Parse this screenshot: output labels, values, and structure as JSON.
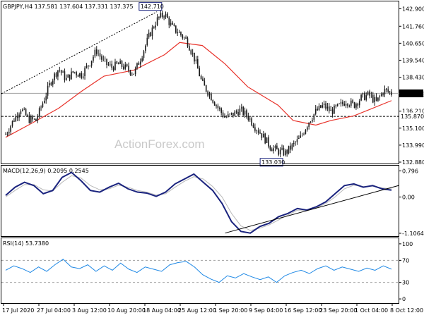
{
  "chart_data": [
    {
      "type": "candlestick",
      "header": "GBPJPY,H4  137.581 137.604 137.331 137.375",
      "watermark": "ActionForex.com",
      "ylim": [
        132.88,
        143.2
      ],
      "yticks": [
        132.88,
        133.99,
        135.1,
        136.21,
        137.32,
        138.43,
        139.54,
        140.65,
        141.76,
        142.9
      ],
      "ytick_labels": [
        "132.880",
        "133.990",
        "135.100",
        "136.210",
        "137.320",
        "138.430",
        "139.540",
        "140.650",
        "141.760",
        "142.900"
      ],
      "last_price": 137.375,
      "last_price_label": "137.375",
      "level_line": 135.87,
      "level_label": "135.870",
      "high_annotation": {
        "value": 142.71,
        "label": "142.710"
      },
      "low_annotation": {
        "value": 133.03,
        "label": "133.030"
      },
      "trendline": {
        "from": {
          "x": "17 Jul 2020",
          "y": 137.35
        },
        "to": {
          "x": "27 Aug 2020",
          "y": 142.71
        }
      },
      "price_path": [
        [
          "17 Jul",
          134.7
        ],
        [
          "20 Jul",
          135.6
        ],
        [
          "22 Jul",
          136.4
        ],
        [
          "24 Jul",
          135.7
        ],
        [
          "27 Jul",
          135.6
        ],
        [
          "28 Jul",
          136.9
        ],
        [
          "30 Jul",
          138.2
        ],
        [
          "31 Jul",
          139.0
        ],
        [
          "3 Aug",
          138.3
        ],
        [
          "5 Aug",
          138.8
        ],
        [
          "7 Aug",
          138.6
        ],
        [
          "10 Aug",
          139.3
        ],
        [
          "12 Aug",
          140.2
        ],
        [
          "14 Aug",
          139.4
        ],
        [
          "17 Aug",
          139.1
        ],
        [
          "18 Aug",
          139.3
        ],
        [
          "20 Aug",
          139.0
        ],
        [
          "21 Aug",
          138.7
        ],
        [
          "24 Aug",
          139.9
        ],
        [
          "26 Aug",
          141.2
        ],
        [
          "27 Aug",
          142.2
        ],
        [
          "28 Aug",
          142.6
        ],
        [
          "31 Aug",
          141.7
        ],
        [
          "1 Sep",
          141.3
        ],
        [
          "2 Sep",
          140.8
        ],
        [
          "3 Sep",
          139.6
        ],
        [
          "4 Sep",
          138.0
        ],
        [
          "7 Sep",
          137.3
        ],
        [
          "8 Sep",
          136.5
        ],
        [
          "9 Sep",
          135.8
        ],
        [
          "10 Sep",
          136.0
        ],
        [
          "11 Sep",
          136.3
        ],
        [
          "14 Sep",
          135.9
        ],
        [
          "15 Sep",
          135.2
        ],
        [
          "16 Sep",
          134.6
        ],
        [
          "17 Sep",
          133.9
        ],
        [
          "18 Sep",
          133.6
        ],
        [
          "21 Sep",
          133.5
        ],
        [
          "22 Sep",
          134.0
        ],
        [
          "23 Sep",
          134.5
        ],
        [
          "24 Sep",
          135.5
        ],
        [
          "25 Sep",
          136.2
        ],
        [
          "28 Sep",
          136.6
        ],
        [
          "29 Sep",
          136.2
        ],
        [
          "30 Sep",
          136.5
        ],
        [
          "1 Oct",
          136.9
        ],
        [
          "2 Oct",
          136.6
        ],
        [
          "5 Oct",
          137.1
        ],
        [
          "6 Oct",
          137.3
        ],
        [
          "7 Oct",
          136.8
        ],
        [
          "8 Oct",
          137.6
        ],
        [
          "9 Oct",
          137.4
        ]
      ],
      "ma_path": [
        [
          "17 Jul",
          134.5
        ],
        [
          "24 Jul",
          135.3
        ],
        [
          "31 Jul",
          136.4
        ],
        [
          "7 Aug",
          137.5
        ],
        [
          "14 Aug",
          138.5
        ],
        [
          "21 Aug",
          138.9
        ],
        [
          "28 Aug",
          139.9
        ],
        [
          "1 Sep",
          140.7
        ],
        [
          "4 Sep",
          140.5
        ],
        [
          "9 Sep",
          139.3
        ],
        [
          "14 Sep",
          137.8
        ],
        [
          "18 Sep",
          136.6
        ],
        [
          "22 Sep",
          135.6
        ],
        [
          "25 Sep",
          135.3
        ],
        [
          "29 Sep",
          135.6
        ],
        [
          "2 Oct",
          135.9
        ],
        [
          "6 Oct",
          136.3
        ],
        [
          "9 Oct",
          136.9
        ]
      ],
      "xtick_labels": [
        "17 Jul 2020",
        "27 Jul 04:00",
        "3 Aug 12:00",
        "10 Aug 20:00",
        "18 Aug 04:00",
        "25 Aug 12:00",
        "1 Sep 20:00",
        "9 Sep 04:00",
        "16 Sep 12:00",
        "23 Sep 20:00",
        "1 Oct 04:00",
        "8 Oct 12:00"
      ],
      "grid": false
    },
    {
      "type": "line",
      "title": "MACD(12,26,9) 0.2095 0.2545",
      "ylim": [
        -1.15,
        0.85
      ],
      "yticks": [
        0.796,
        0.0,
        -1.1064
      ],
      "ytick_labels": [
        "0.796",
        "0.00",
        "-1.1064"
      ],
      "series": [
        {
          "name": "MACD",
          "values": [
            0.05,
            0.3,
            0.45,
            0.35,
            0.1,
            0.2,
            0.6,
            0.75,
            0.5,
            0.2,
            0.15,
            0.3,
            0.42,
            0.25,
            0.15,
            0.12,
            0.02,
            0.15,
            0.4,
            0.55,
            0.7,
            0.45,
            0.2,
            -0.2,
            -0.75,
            -1.05,
            -1.1,
            -0.9,
            -0.8,
            -0.6,
            -0.5,
            -0.35,
            -0.4,
            -0.3,
            -0.15,
            0.1,
            0.35,
            0.4,
            0.3,
            0.35,
            0.25,
            0.21
          ]
        },
        {
          "name": "Signal",
          "values": [
            0.0,
            0.2,
            0.38,
            0.38,
            0.22,
            0.18,
            0.45,
            0.65,
            0.58,
            0.35,
            0.22,
            0.25,
            0.36,
            0.3,
            0.2,
            0.15,
            0.06,
            0.1,
            0.3,
            0.48,
            0.62,
            0.55,
            0.32,
            0.0,
            -0.5,
            -0.88,
            -1.02,
            -0.95,
            -0.85,
            -0.7,
            -0.55,
            -0.4,
            -0.4,
            -0.34,
            -0.2,
            0.0,
            0.25,
            0.36,
            0.32,
            0.33,
            0.28,
            0.25
          ]
        }
      ],
      "trendline": {
        "from": {
          "x": "9 Sep 2020",
          "y": -1.1
        },
        "to": {
          "x": "9 Oct 2020",
          "y": 0.35
        }
      }
    },
    {
      "type": "line",
      "title": "RSI(14) 53.7380",
      "ylim": [
        0,
        100
      ],
      "yticks": [
        100,
        70,
        30,
        0
      ],
      "ytick_labels": [
        "100",
        "70",
        "30",
        "0"
      ],
      "series": [
        {
          "name": "RSI",
          "values": [
            52,
            60,
            55,
            48,
            58,
            50,
            62,
            72,
            58,
            55,
            62,
            50,
            60,
            52,
            65,
            54,
            48,
            58,
            54,
            50,
            62,
            66,
            68,
            58,
            44,
            36,
            30,
            42,
            38,
            46,
            40,
            35,
            40,
            30,
            42,
            48,
            52,
            46,
            55,
            60,
            52,
            58,
            54,
            50,
            56,
            52,
            60,
            54
          ]
        }
      ],
      "levels": [
        70,
        30
      ]
    }
  ]
}
